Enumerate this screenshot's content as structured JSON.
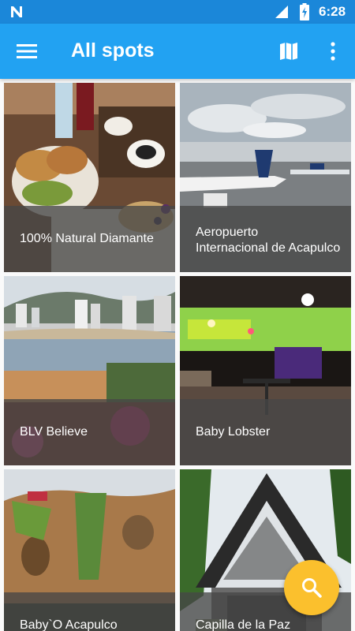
{
  "status_bar": {
    "time": "6:28",
    "icons": [
      "notification-n-icon",
      "signal-icon",
      "battery-charging-icon"
    ]
  },
  "app_bar": {
    "title": "All spots",
    "icons": [
      "menu-icon",
      "map-icon",
      "more-vert-icon"
    ]
  },
  "spots": [
    {
      "name": "100% Natural Diamante",
      "lines": [
        "100% Natural Diamante"
      ]
    },
    {
      "name": "Aeropuerto Internacional de Acapulco",
      "lines": [
        "Aeropuerto",
        "Internacional de Acapulco"
      ]
    },
    {
      "name": "BLV Believe",
      "lines": [
        "BLV Believe"
      ]
    },
    {
      "name": "Baby Lobster",
      "lines": [
        "Baby Lobster"
      ]
    },
    {
      "name": "Baby`O Acapulco",
      "lines": [
        "Baby`O Acapulco"
      ]
    },
    {
      "name": "Capilla de la Paz",
      "lines": [
        "Capilla de la Paz"
      ]
    }
  ],
  "fab": {
    "icon": "search-icon"
  },
  "colors": {
    "status_bar": "#1b87d9",
    "app_bar": "#22a2f2",
    "fab": "#fbc02d",
    "label_overlay": "#464646"
  }
}
